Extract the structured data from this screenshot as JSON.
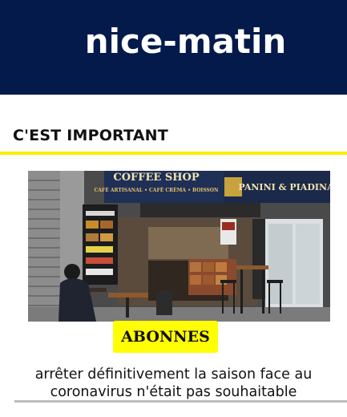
{
  "header": {
    "logo_text": "nice-matin"
  },
  "section": {
    "title": "C'EST IMPORTANT"
  },
  "article": {
    "image_alt": "Coffee shop storefront with a seated customer",
    "photo_signs": {
      "coffee_shop": "COFFEE SHOP",
      "panini": "PANINI & PIADINA",
      "cafe_line": "CAFÉ ARTISANAL • CAFÉ CRÉMA • BOISSON"
    },
    "badge": "ABONNES",
    "headline": "arrêter définitivement la saison face au coronavirus n'était pas souhaitable"
  },
  "colors": {
    "brand_navy": "#031a4a",
    "accent_yellow": "#f7ef00",
    "badge_yellow": "#ffff00"
  }
}
